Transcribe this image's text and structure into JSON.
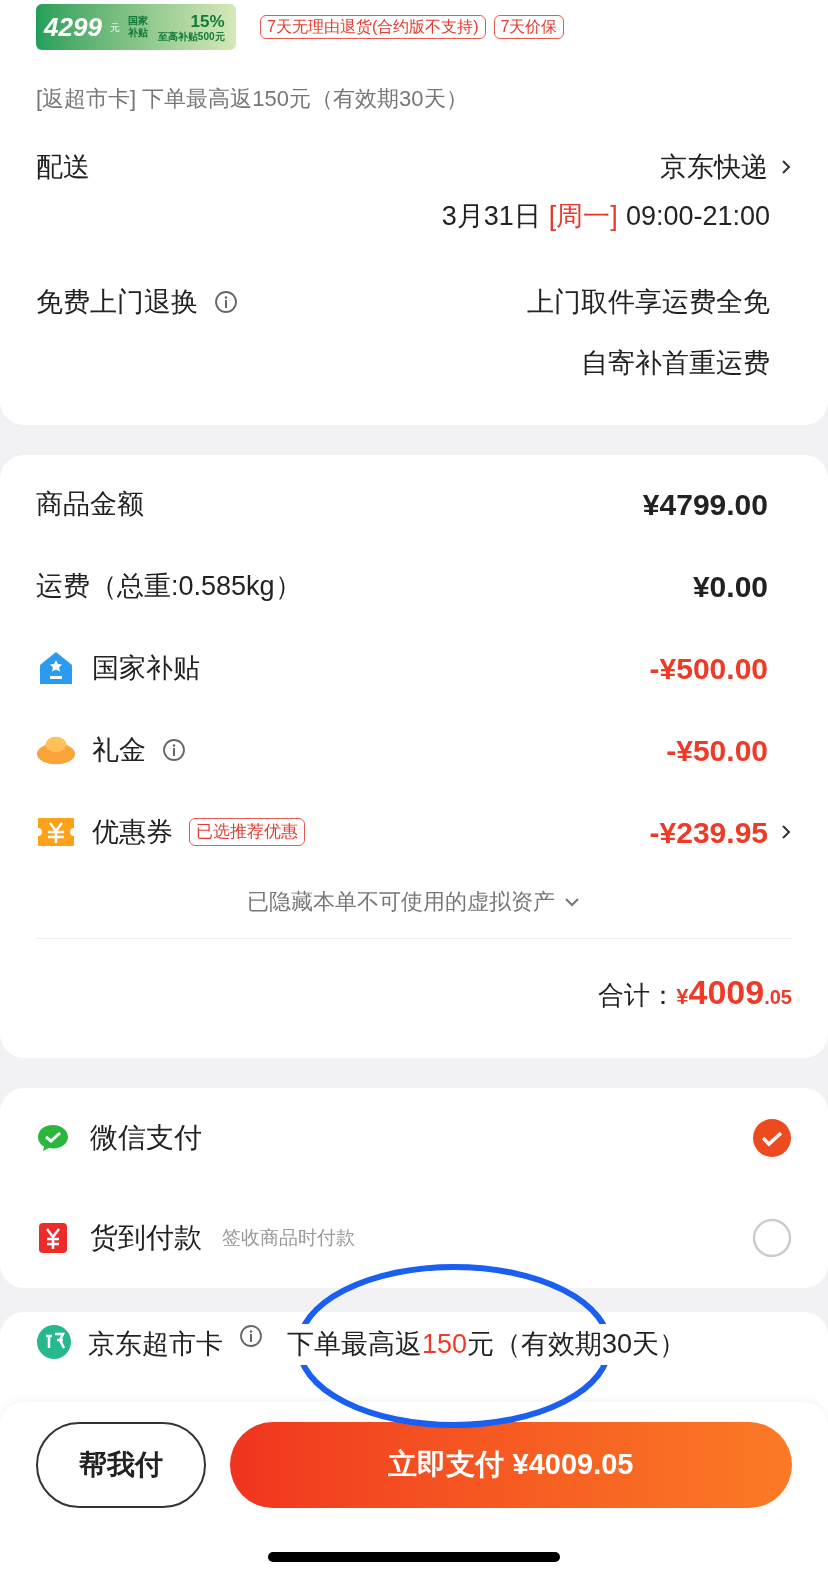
{
  "promo_badge": {
    "price": "4299",
    "unit": "元",
    "label": "国家补贴",
    "percent": "15%",
    "cap": "至高补贴500元"
  },
  "tags": [
    "7天无理由退货(合约版不支持)",
    "7天价保"
  ],
  "rebate_note": "[返超市卡] 下单最高返150元（有效期30天）",
  "delivery": {
    "label": "配送",
    "carrier": "京东快递",
    "date": "3月31日",
    "weekday": "[周一]",
    "time": "09:00-21:00"
  },
  "returns": {
    "label": "免费上门退换",
    "lines": [
      "上门取件享运费全免",
      "自寄补首重运费"
    ]
  },
  "price_rows": [
    {
      "kind": "plain",
      "label": "商品金额",
      "amount": "¥4799.00"
    },
    {
      "kind": "plain",
      "label": "运费（总重:0.585kg）",
      "amount": "¥0.00"
    },
    {
      "kind": "subsidy",
      "label": "国家补贴",
      "amount": "-¥500.00"
    },
    {
      "kind": "gift",
      "label": "礼金",
      "info": true,
      "amount": "-¥50.00"
    },
    {
      "kind": "coupon",
      "label": "优惠券",
      "tag": "已选推荐优惠",
      "amount": "-¥239.95",
      "arrow": true
    }
  ],
  "hidden_assets": "已隐藏本单不可使用的虚拟资产",
  "total": {
    "label": "合计：",
    "currency": "¥",
    "integer": "4009",
    "decimal": ".05"
  },
  "payment_methods": [
    {
      "kind": "wechat",
      "label": "微信支付",
      "selected": true
    },
    {
      "kind": "cod",
      "label": "货到付款",
      "hint": "签收商品时付款",
      "selected": false
    }
  ],
  "supermarket_card": {
    "label": "京东超市卡",
    "text": "下单最高返**150**元（有效期30天）"
  },
  "annotation": {
    "kind": "ellipse"
  },
  "buttons": {
    "help_pay": "帮我付",
    "pay": "立即支付 ¥4009.05"
  }
}
